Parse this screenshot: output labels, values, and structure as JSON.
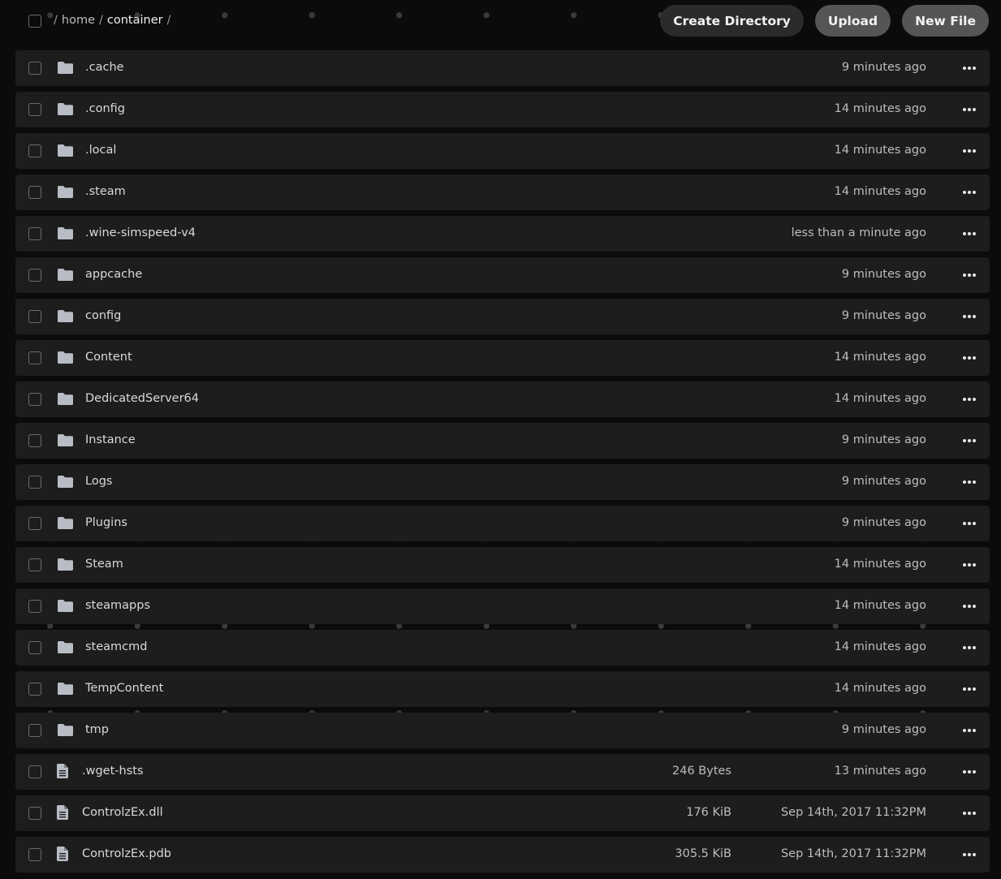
{
  "breadcrumb": {
    "separator": "/",
    "items": [
      {
        "label": "home",
        "current": false
      },
      {
        "label": "container",
        "current": true
      }
    ]
  },
  "actions": {
    "create_directory": "Create Directory",
    "upload": "Upload",
    "new_file": "New File"
  },
  "icons": {
    "folder": "folder-icon",
    "file": "file-icon",
    "more": "more-options-icon"
  },
  "colors": {
    "background": "#0b0b0b",
    "row": "#1d1d1d",
    "button_dark": "#2b2b2b",
    "button_grey": "#555555"
  },
  "files": [
    {
      "type": "folder",
      "name": ".cache",
      "size": "",
      "modified": "9 minutes ago"
    },
    {
      "type": "folder",
      "name": ".config",
      "size": "",
      "modified": "14 minutes ago"
    },
    {
      "type": "folder",
      "name": ".local",
      "size": "",
      "modified": "14 minutes ago"
    },
    {
      "type": "folder",
      "name": ".steam",
      "size": "",
      "modified": "14 minutes ago"
    },
    {
      "type": "folder",
      "name": ".wine-simspeed-v4",
      "size": "",
      "modified": "less than a minute ago"
    },
    {
      "type": "folder",
      "name": "appcache",
      "size": "",
      "modified": "9 minutes ago"
    },
    {
      "type": "folder",
      "name": "config",
      "size": "",
      "modified": "9 minutes ago"
    },
    {
      "type": "folder",
      "name": "Content",
      "size": "",
      "modified": "14 minutes ago"
    },
    {
      "type": "folder",
      "name": "DedicatedServer64",
      "size": "",
      "modified": "14 minutes ago"
    },
    {
      "type": "folder",
      "name": "Instance",
      "size": "",
      "modified": "9 minutes ago"
    },
    {
      "type": "folder",
      "name": "Logs",
      "size": "",
      "modified": "9 minutes ago"
    },
    {
      "type": "folder",
      "name": "Plugins",
      "size": "",
      "modified": "9 minutes ago"
    },
    {
      "type": "folder",
      "name": "Steam",
      "size": "",
      "modified": "14 minutes ago"
    },
    {
      "type": "folder",
      "name": "steamapps",
      "size": "",
      "modified": "14 minutes ago"
    },
    {
      "type": "folder",
      "name": "steamcmd",
      "size": "",
      "modified": "14 minutes ago"
    },
    {
      "type": "folder",
      "name": "TempContent",
      "size": "",
      "modified": "14 minutes ago"
    },
    {
      "type": "folder",
      "name": "tmp",
      "size": "",
      "modified": "9 minutes ago"
    },
    {
      "type": "file",
      "name": ".wget-hsts",
      "size": "246 Bytes",
      "modified": "13 minutes ago"
    },
    {
      "type": "file",
      "name": "ControlzEx.dll",
      "size": "176 KiB",
      "modified": "Sep 14th, 2017 11:32PM"
    },
    {
      "type": "file",
      "name": "ControlzEx.pdb",
      "size": "305.5 KiB",
      "modified": "Sep 14th, 2017 11:32PM"
    }
  ]
}
